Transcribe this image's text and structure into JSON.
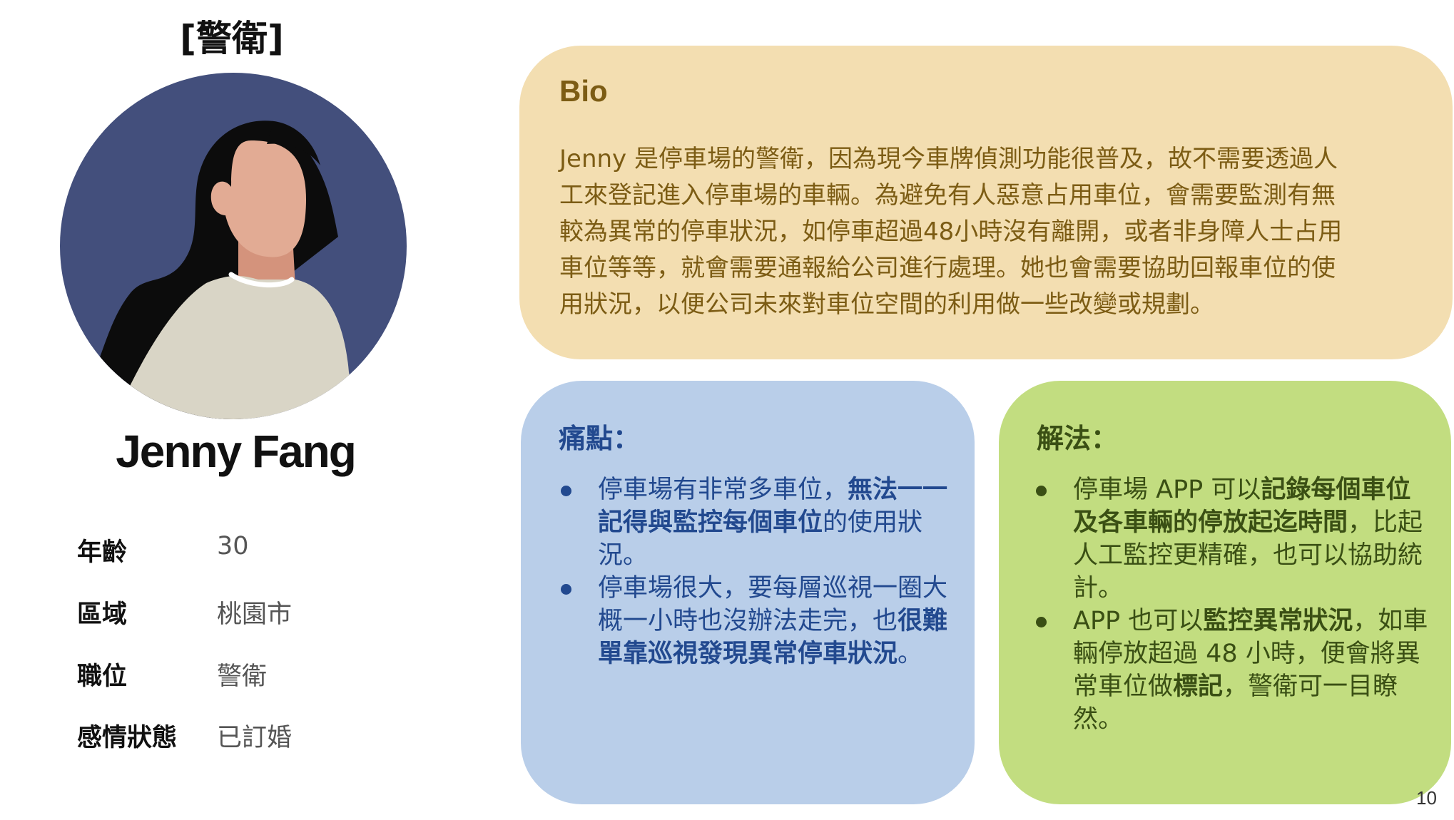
{
  "persona": {
    "role_title": "[警衛]",
    "name": "Jenny Fang",
    "avatar_icon": "woman-avatar-icon",
    "info": [
      {
        "label": "年齡",
        "value": "30"
      },
      {
        "label": "區域",
        "value": "桃園市"
      },
      {
        "label": "職位",
        "value": "警衛"
      },
      {
        "label": "感情狀態",
        "value": "已訂婚"
      }
    ]
  },
  "bio": {
    "title": "Bio",
    "lines": [
      "Jenny 是停車場的警衛，因為現今車牌偵測功能很普及，故不需要透過人",
      "工來登記進入停車場的車輛。為避免有人惡意占用車位，會需要監測有無",
      "較為異常的停車狀況，如停車超過48小時沒有離開，或者非身障人士占用",
      "車位等等，就會需要通報給公司進行處理。她也會需要協助回報車位的使",
      "用狀況，以便公司未來對車位空間的利用做一些改變或規劃。"
    ]
  },
  "pain_points": {
    "title": "痛點：",
    "items": [
      {
        "pre": "停車場有非常多車位，",
        "bold": "無法一一記得與監控每個車位",
        "post": "的使用狀況。"
      },
      {
        "pre": "停車場很大，要每層巡視一圈大概一小時也沒辦法走完，也",
        "bold": "很難單靠巡視發現異常停車狀況",
        "post": "。"
      }
    ]
  },
  "solutions": {
    "title": "解法：",
    "items": [
      {
        "pre": "停車場 APP 可以",
        "bold": "記錄每個車位及各車輛的停放起迄時間",
        "post": "，比起人工監控更精確，也可以協助統計。"
      },
      {
        "pre": "APP 也可以",
        "bold": "監控異常狀況",
        "mid": "，如車輛停放超過 48 小時，便會將異常車位做",
        "bold2": "標記",
        "post": "，警衛可一目瞭然。"
      }
    ]
  },
  "page_number": "10",
  "colors": {
    "bio_bg": "#f3deb1",
    "bio_text": "#7c5c14",
    "pain_bg": "#b9cee9",
    "pain_text": "#22498f",
    "solution_bg": "#c2dd80",
    "solution_text": "#3a4f14",
    "avatar_bg": "#434f7c"
  }
}
